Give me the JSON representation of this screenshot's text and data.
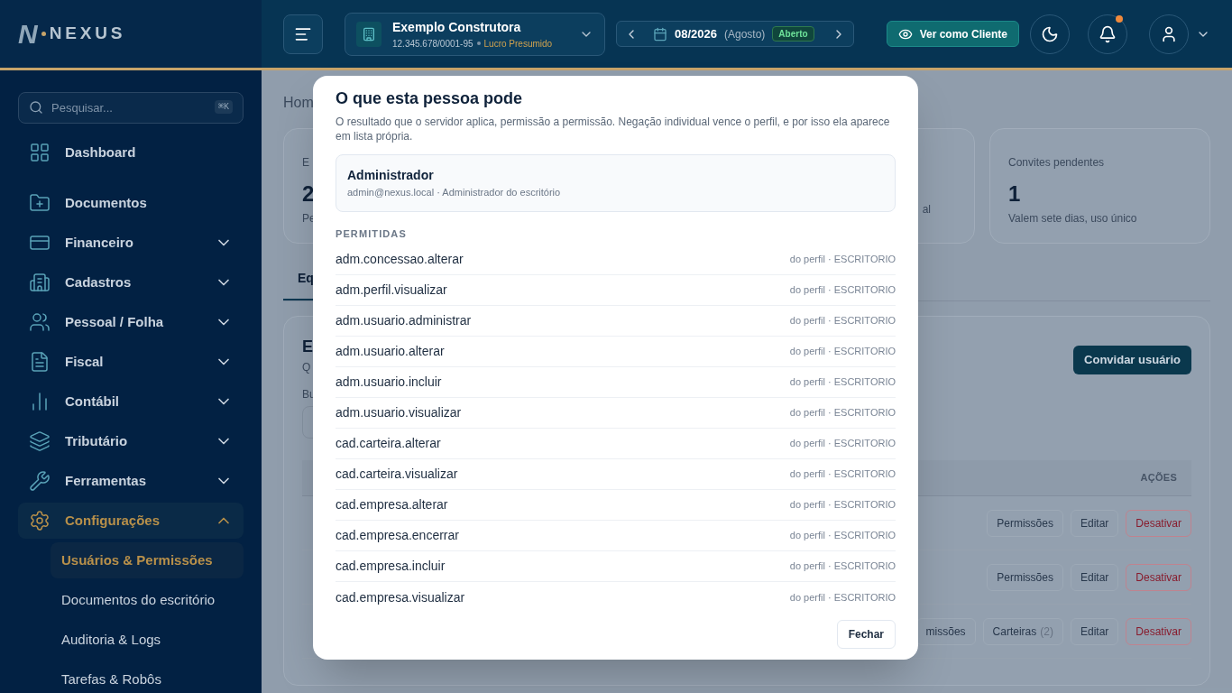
{
  "brand": {
    "mark": "N",
    "name": "NEXUS"
  },
  "header": {
    "company": {
      "name": "Exemplo Construtora",
      "cnpj": "12.345.678/0001-95",
      "regime": "Lucro Presumido"
    },
    "period": {
      "value": "08/2026",
      "month": "(Agosto)",
      "status": "Aberto"
    },
    "client_view_button": "Ver como Cliente",
    "notifications_unread": true
  },
  "sidebar": {
    "search": {
      "placeholder": "Pesquisar...",
      "shortcut": "⌘K"
    },
    "items": [
      {
        "label": "Dashboard",
        "kind": "link",
        "selected": false
      },
      {
        "label": "Documentos",
        "kind": "link",
        "selected": false
      },
      {
        "label": "Financeiro",
        "kind": "group",
        "expanded": false,
        "selected": false
      },
      {
        "label": "Cadastros",
        "kind": "group",
        "expanded": false,
        "selected": false
      },
      {
        "label": "Pessoal / Folha",
        "kind": "group",
        "expanded": false,
        "selected": false
      },
      {
        "label": "Fiscal",
        "kind": "group",
        "expanded": false,
        "selected": false
      },
      {
        "label": "Contábil",
        "kind": "group",
        "expanded": false,
        "selected": false
      },
      {
        "label": "Tributário",
        "kind": "group",
        "expanded": false,
        "selected": false
      },
      {
        "label": "Ferramentas",
        "kind": "group",
        "expanded": false,
        "selected": false
      },
      {
        "label": "Configurações",
        "kind": "group",
        "expanded": true,
        "selected": true,
        "children": [
          {
            "label": "Usuários & Permissões",
            "selected": true
          },
          {
            "label": "Documentos do escritório",
            "selected": false
          },
          {
            "label": "Auditoria & Logs",
            "selected": false
          },
          {
            "label": "Tarefas & Robôs",
            "selected": false
          }
        ]
      }
    ]
  },
  "page": {
    "breadcrumb": "Hom",
    "stats": [
      {
        "title": "E",
        "value": "2",
        "note": "Pe"
      },
      {
        "note": "al"
      },
      {
        "title": "Convites pendentes",
        "value": "1",
        "note": "Valem sete dias, uso único"
      }
    ],
    "tabs": [
      {
        "label": "Eq",
        "selected": true
      }
    ],
    "section": {
      "title": "E",
      "subtitle": "Q",
      "search_label": "Bu",
      "invite_button": "Convidar usuário",
      "actions_header": "AÇÕES",
      "rows": [
        {
          "buttons": [
            {
              "label": "Permissões",
              "kind": "neutral"
            },
            {
              "label": "Editar",
              "kind": "neutral"
            },
            {
              "label": "Desativar",
              "kind": "danger"
            }
          ]
        },
        {
          "buttons": [
            {
              "label": "Permissões",
              "kind": "neutral"
            },
            {
              "label": "Editar",
              "kind": "neutral"
            },
            {
              "label": "Desativar",
              "kind": "danger"
            }
          ]
        },
        {
          "buttons": [
            {
              "label": "missões",
              "kind": "neutral"
            },
            {
              "label": "Carteiras",
              "count": "(2)",
              "kind": "neutral"
            },
            {
              "label": "Editar",
              "kind": "neutral"
            },
            {
              "label": "Desativar",
              "kind": "danger"
            }
          ]
        }
      ]
    }
  },
  "modal": {
    "title": "O que esta pessoa pode",
    "description": "O resultado que o servidor aplica, permissão a permissão. Negação individual vence o perfil, e por isso ela aparece em lista própria.",
    "user": {
      "name": "Administrador",
      "detail": "admin@nexus.local · Administrador do escritório"
    },
    "section_label": "PERMITIDAS",
    "permissions": [
      {
        "code": "adm.concessao.alterar",
        "source": "do perfil · ESCRITORIO"
      },
      {
        "code": "adm.perfil.visualizar",
        "source": "do perfil · ESCRITORIO"
      },
      {
        "code": "adm.usuario.administrar",
        "source": "do perfil · ESCRITORIO"
      },
      {
        "code": "adm.usuario.alterar",
        "source": "do perfil · ESCRITORIO"
      },
      {
        "code": "adm.usuario.incluir",
        "source": "do perfil · ESCRITORIO"
      },
      {
        "code": "adm.usuario.visualizar",
        "source": "do perfil · ESCRITORIO"
      },
      {
        "code": "cad.carteira.alterar",
        "source": "do perfil · ESCRITORIO"
      },
      {
        "code": "cad.carteira.visualizar",
        "source": "do perfil · ESCRITORIO"
      },
      {
        "code": "cad.empresa.alterar",
        "source": "do perfil · ESCRITORIO"
      },
      {
        "code": "cad.empresa.encerrar",
        "source": "do perfil · ESCRITORIO"
      },
      {
        "code": "cad.empresa.incluir",
        "source": "do perfil · ESCRITORIO"
      },
      {
        "code": "cad.empresa.visualizar",
        "source": "do perfil · ESCRITORIO"
      }
    ],
    "close_button": "Fechar"
  }
}
